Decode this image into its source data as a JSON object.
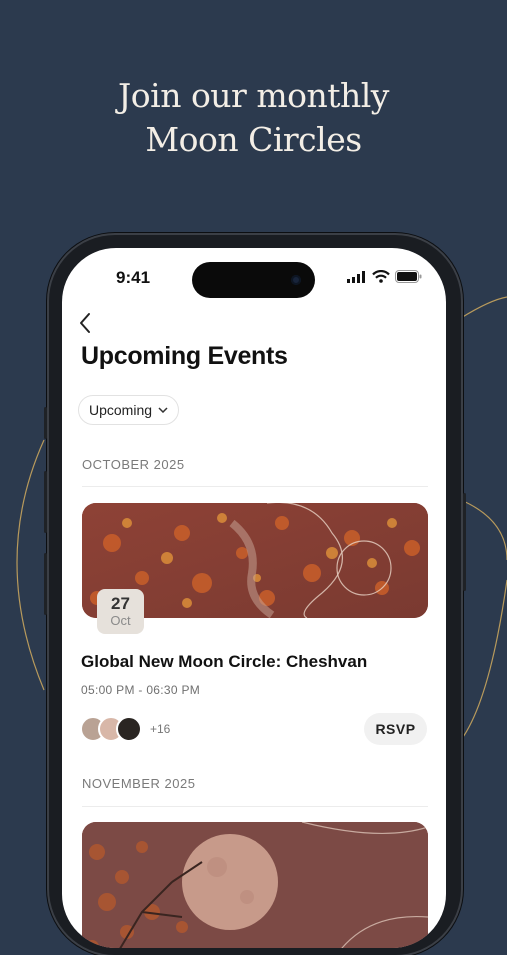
{
  "headline": {
    "line1": "Join our monthly",
    "line2": "Moon Circles"
  },
  "status_bar": {
    "time": "9:41"
  },
  "header": {
    "title": "Upcoming Events"
  },
  "filter": {
    "label": "Upcoming"
  },
  "sections": [
    {
      "month": "OCTOBER 2025",
      "event": {
        "day": "27",
        "month_abbr": "Oct",
        "title": "Global New Moon Circle: Cheshvan",
        "time": "05:00 PM - 06:30 PM",
        "attendees_more": "+16",
        "rsvp_label": "RSVP"
      }
    },
    {
      "month": "NOVEMBER 2025"
    }
  ],
  "colors": {
    "background": "#2c3a4e",
    "gold_line": "#b89a5c",
    "card_image": "#8a3f34"
  }
}
